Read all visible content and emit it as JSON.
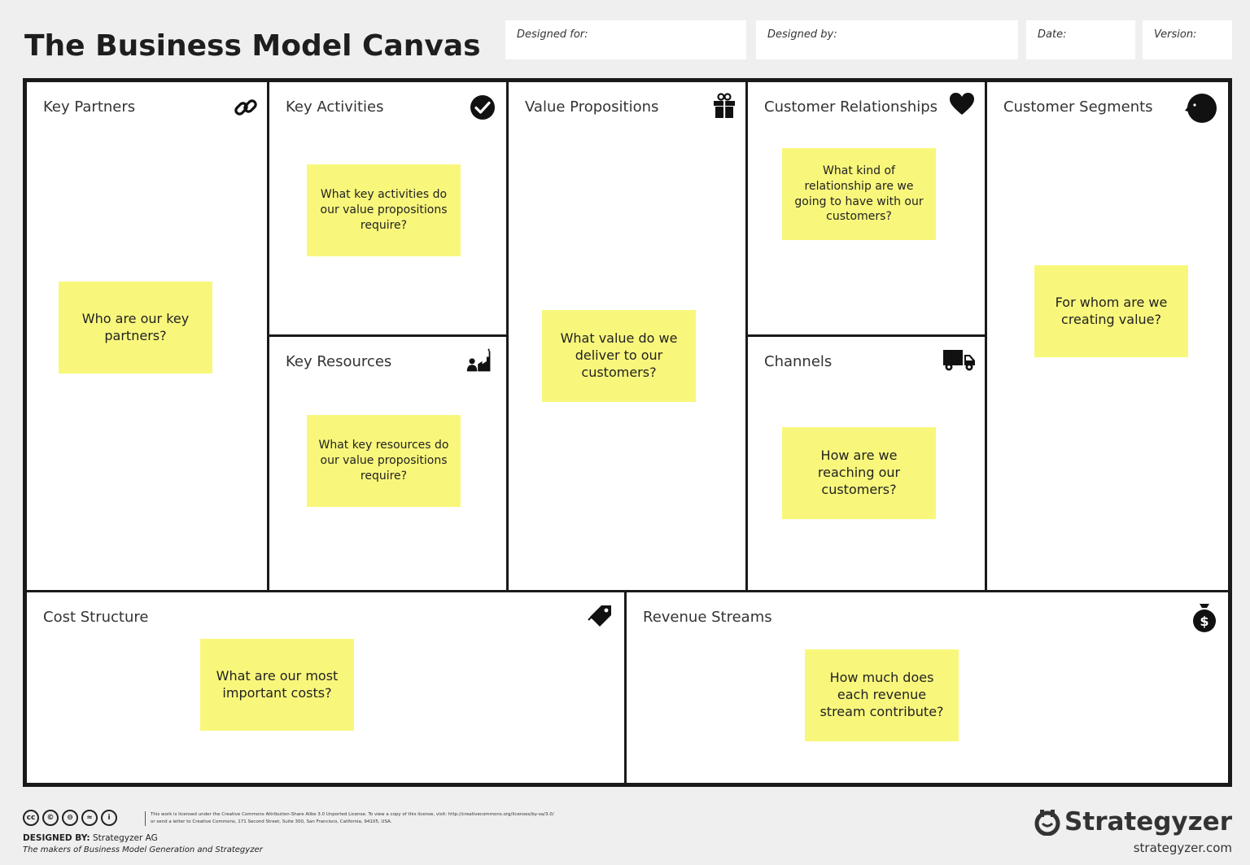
{
  "title": "The Business Model Canvas",
  "meta": {
    "designed_for": "Designed for:",
    "designed_by": "Designed by:",
    "date": "Date:",
    "version": "Version:"
  },
  "blocks": {
    "key_partners": {
      "title": "Key Partners",
      "icon": "link-icon",
      "prompt": "Who are our key partners?"
    },
    "key_activities": {
      "title": "Key Activities",
      "icon": "checkmark-icon",
      "prompt": "What key activities do our value propositions require?"
    },
    "key_resources": {
      "title": "Key Resources",
      "icon": "factory-worker-icon",
      "prompt": "What key resources do our value propositions require?"
    },
    "value_propositions": {
      "title": "Value Propositions",
      "icon": "gift-icon",
      "prompt": "What value do we deliver to our customers?"
    },
    "customer_relationships": {
      "title": "Customer Relationships",
      "icon": "heart-icon",
      "prompt": "What kind of relationship are we going to have with our customers?"
    },
    "channels": {
      "title": "Channels",
      "icon": "truck-icon",
      "prompt": "How are we reaching our customers?"
    },
    "customer_segments": {
      "title": "Customer Segments",
      "icon": "face-icon",
      "prompt": "For whom are we creating value?"
    },
    "cost_structure": {
      "title": "Cost Structure",
      "icon": "price-tag-icon",
      "prompt": "What are our most important costs?"
    },
    "revenue_streams": {
      "title": "Revenue Streams",
      "icon": "money-bag-icon",
      "prompt": "How much does each revenue stream contribute?"
    }
  },
  "footer": {
    "cc_badges": [
      "cc",
      "©",
      "⊖",
      "≈",
      "i"
    ],
    "license_text": "This work is licensed under the Creative Commons Attribution-Share Alike 3.0 Unported License. To view a copy of this license, visit: http://creativecommons.org/licenses/by-sa/3.0/ or send a letter to Creative Commons, 171 Second Street, Suite 300, San Francisco, California, 94105, USA.",
    "designed_by_label": "DESIGNED BY:",
    "designed_by_value": "Strategyzer AG",
    "makers_text": "The makers of Business Model Generation and Strategyzer",
    "brand_name": "Strategyzer",
    "brand_site": "strategyzer.com"
  },
  "colors": {
    "sticky": "#f8f77c",
    "border": "#1a1a1a",
    "background": "#efefef"
  }
}
